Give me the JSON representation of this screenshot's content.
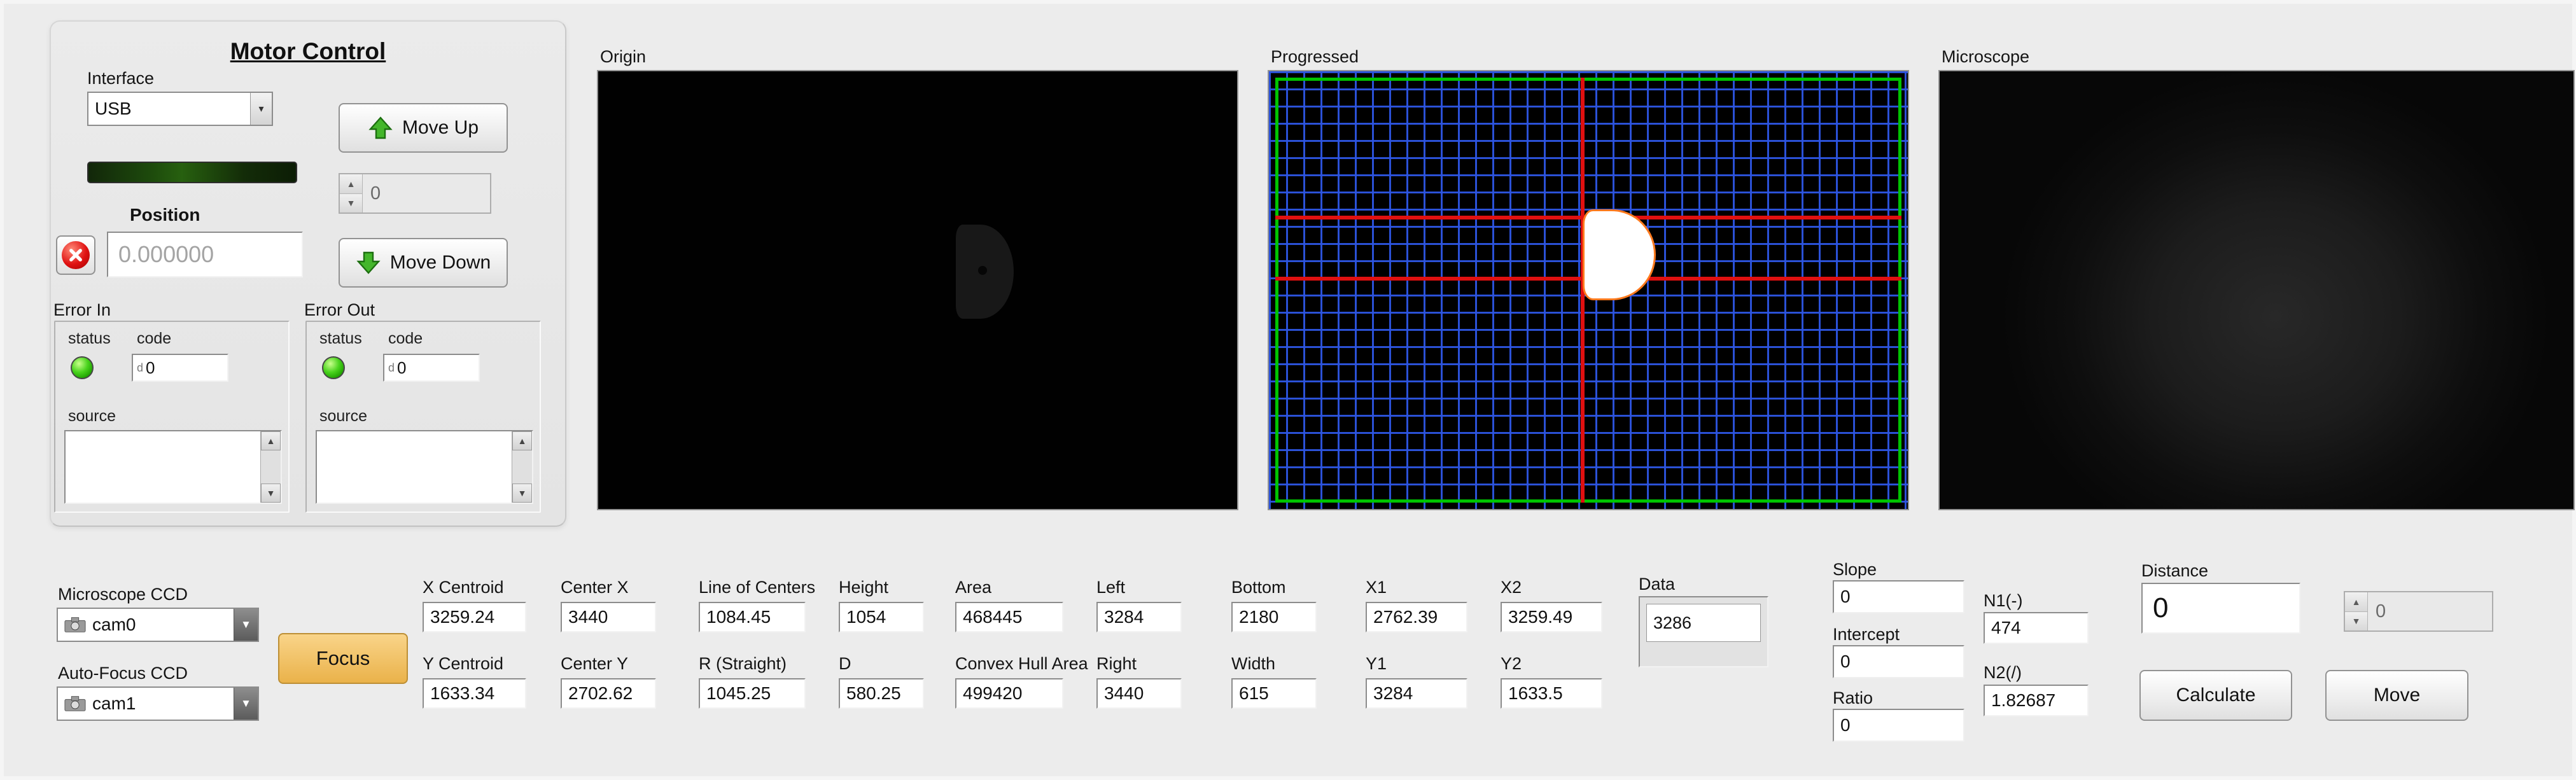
{
  "motor_control": {
    "title": "Motor Control",
    "interface": {
      "label": "Interface",
      "value": "USB"
    },
    "position": {
      "label": "Position",
      "value": "0.000000"
    },
    "move_up_button": "Move Up",
    "move_down_button": "Move Down",
    "step_value": "0",
    "error_in": {
      "label": "Error In",
      "status_label": "status",
      "code_label": "code",
      "code_radix": "d",
      "code_value": "0",
      "source_label": "source",
      "source_value": ""
    },
    "error_out": {
      "label": "Error Out",
      "status_label": "status",
      "code_label": "code",
      "code_radix": "d",
      "code_value": "0",
      "source_label": "source",
      "source_value": ""
    }
  },
  "displays": {
    "origin_label": "Origin",
    "progressed_label": "Progressed",
    "microscope_label": "Microscope"
  },
  "cameras": {
    "microscope_ccd": {
      "label": "Microscope CCD",
      "value": "cam0"
    },
    "autofocus_ccd": {
      "label": "Auto-Focus CCD",
      "value": "cam1"
    },
    "focus_button": "Focus"
  },
  "measurements": {
    "row1": [
      {
        "label": "X Centroid",
        "value": "3259.24"
      },
      {
        "label": "Center X",
        "value": "3440"
      },
      {
        "label": "Line of Centers",
        "value": "1084.45"
      },
      {
        "label": "Height",
        "value": "1054"
      },
      {
        "label": "Area",
        "value": "468445"
      },
      {
        "label": "Left",
        "value": "3284"
      },
      {
        "label": "Bottom",
        "value": "2180"
      },
      {
        "label": "X1",
        "value": "2762.39"
      },
      {
        "label": "X2",
        "value": "3259.49"
      }
    ],
    "row2": [
      {
        "label": "Y Centroid",
        "value": "1633.34"
      },
      {
        "label": "Center Y",
        "value": "2702.62"
      },
      {
        "label": "R (Straight)",
        "value": "1045.25"
      },
      {
        "label": "D",
        "value": "580.25"
      },
      {
        "label": "Convex Hull Area",
        "value": "499420"
      },
      {
        "label": "Right",
        "value": "3440"
      },
      {
        "label": "Width",
        "value": "615"
      },
      {
        "label": "Y1",
        "value": "3284"
      },
      {
        "label": "Y2",
        "value": "1633.5"
      }
    ],
    "data": {
      "label": "Data",
      "items": [
        "3286"
      ]
    }
  },
  "calculation": {
    "slope": {
      "label": "Slope",
      "value": "0"
    },
    "intercept": {
      "label": "Intercept",
      "value": "0"
    },
    "ratio": {
      "label": "Ratio",
      "value": "0"
    },
    "n1": {
      "label": "N1(-)",
      "value": "474"
    },
    "n2": {
      "label": "N2(/)",
      "value": "1.82687"
    },
    "distance": {
      "label": "Distance",
      "value": "0"
    },
    "target_value": "0",
    "calculate_button": "Calculate",
    "move_button": "Move"
  }
}
